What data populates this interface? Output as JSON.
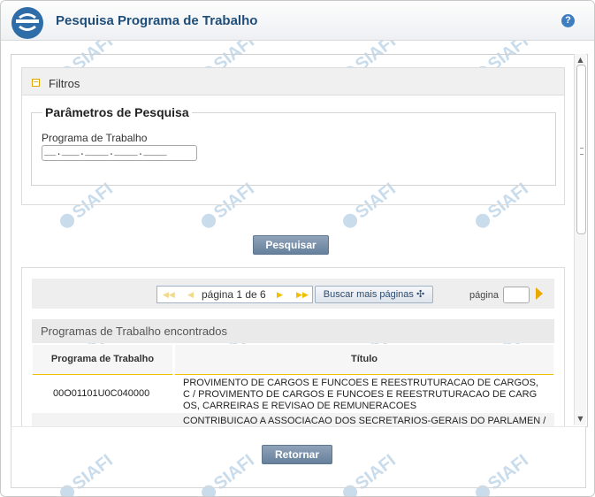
{
  "header": {
    "title": "Pesquisa Programa de Trabalho",
    "help_glyph": "?"
  },
  "watermark": {
    "text": "SIAFI"
  },
  "filters": {
    "toggle_glyph": "−",
    "label": "Filtros",
    "legend": "Parâmetros de Pesquisa",
    "program_label": "Programa de Trabalho",
    "program_mask": "__.___.____.____.____"
  },
  "search_button": "Pesquisar",
  "pager": {
    "first_glyph": "◀◀",
    "prev_glyph": "◀",
    "next_glyph": "▶",
    "last_glyph": "▶▶",
    "status": "página 1 de 6",
    "more_label": "Buscar mais páginas ✣",
    "page_label": "página"
  },
  "results": {
    "caption": "Programas de Trabalho encontrados",
    "columns": [
      "Programa de Trabalho",
      "Título"
    ],
    "rows": [
      {
        "code": "00O01101U0C040000",
        "title_lines": [
          "PROVIMENTO DE CARGOS E FUNCOES E REESTRUTURACAO DE CARGOS,",
          "C / PROVIMENTO DE CARGOS E FUNCOES E REESTRUTURACAO DE CARG",
          "OS, CARREIRAS E REVISAO DE REMUNERACOES"
        ]
      },
      {
        "code": "",
        "title_lines": [
          "CONTRIBUICAO A ASSOCIACAO DOS SECRETARIOS-GERAIS DO PARLAMEN /"
        ]
      }
    ]
  },
  "footer": {
    "return_button": "Retornar"
  },
  "colors": {
    "accent": "#f0c000",
    "title": "#1f4e79",
    "button": "#66809c"
  }
}
